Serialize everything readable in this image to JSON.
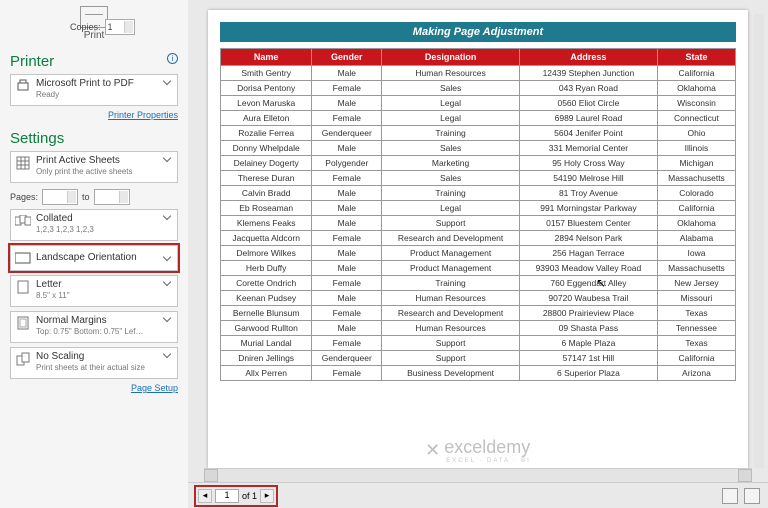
{
  "sidebar": {
    "print_label": "Print",
    "copies_label": "Copies:",
    "copies_value": "1",
    "printer_title": "Printer",
    "printer": {
      "name": "Microsoft Print to PDF",
      "status": "Ready"
    },
    "printer_properties": "Printer Properties",
    "settings_title": "Settings",
    "active_sheets": {
      "title": "Print Active Sheets",
      "sub": "Only print the active sheets"
    },
    "pages_label": "Pages:",
    "pages_to": "to",
    "collated": {
      "title": "Collated",
      "sub": "1,2,3   1,2,3   1,2,3"
    },
    "orientation": {
      "title": "Landscape Orientation"
    },
    "paper": {
      "title": "Letter",
      "sub": "8.5\" x 11\""
    },
    "margins": {
      "title": "Normal Margins",
      "sub": "Top: 0.75\" Bottom: 0.75\" Lef…"
    },
    "scaling": {
      "title": "No Scaling",
      "sub": "Print sheets at their actual size"
    },
    "page_setup": "Page Setup"
  },
  "preview": {
    "banner": "Making Page Adjustment",
    "watermark": "exceldemy",
    "watermark_sub": "EXCEL · DATA · BI",
    "footer": {
      "page": "1",
      "of": "of 1"
    }
  },
  "table": {
    "headers": [
      "Name",
      "Gender",
      "Designation",
      "Address",
      "State"
    ],
    "rows": [
      [
        "Smith Gentry",
        "Male",
        "Human Resources",
        "12439 Stephen Junction",
        "California"
      ],
      [
        "Dorisa Pentony",
        "Female",
        "Sales",
        "043 Ryan Road",
        "Oklahoma"
      ],
      [
        "Levon Maruska",
        "Male",
        "Legal",
        "0560 Eliot Circle",
        "Wisconsin"
      ],
      [
        "Aura Elleton",
        "Female",
        "Legal",
        "6989 Laurel Road",
        "Connecticut"
      ],
      [
        "Rozalie Ferrea",
        "Genderqueer",
        "Training",
        "5604 Jenifer Point",
        "Ohio"
      ],
      [
        "Donny Whelpdale",
        "Male",
        "Sales",
        "331 Memorial Center",
        "Illinois"
      ],
      [
        "Delainey Dogerty",
        "Polygender",
        "Marketing",
        "95 Holy Cross Way",
        "Michigan"
      ],
      [
        "Therese Duran",
        "Female",
        "Sales",
        "54190 Melrose Hill",
        "Massachusetts"
      ],
      [
        "Calvin Bradd",
        "Male",
        "Training",
        "81 Troy Avenue",
        "Colorado"
      ],
      [
        "Eb Roseaman",
        "Male",
        "Legal",
        "991 Morningstar Parkway",
        "California"
      ],
      [
        "Klemens Feaks",
        "Male",
        "Support",
        "0157 Bluestem Center",
        "Oklahoma"
      ],
      [
        "Jacquetta Aldcorn",
        "Female",
        "Research and Development",
        "2894 Nelson Park",
        "Alabama"
      ],
      [
        "Delmore Wilkes",
        "Male",
        "Product Management",
        "256 Hagan Terrace",
        "Iowa"
      ],
      [
        "Herb Duffy",
        "Male",
        "Product Management",
        "93903 Meadow Valley Road",
        "Massachusetts"
      ],
      [
        "Corette Ondrich",
        "Female",
        "Training",
        "760 Eggendart Alley",
        "New Jersey"
      ],
      [
        "Keenan Pudsey",
        "Male",
        "Human Resources",
        "90720 Waubesa Trail",
        "Missouri"
      ],
      [
        "Bernelle Blunsum",
        "Female",
        "Research and Development",
        "28800 Prairieview Place",
        "Texas"
      ],
      [
        "Garwood Rullton",
        "Male",
        "Human Resources",
        "09 Shasta Pass",
        "Tennessee"
      ],
      [
        "Murial Landal",
        "Female",
        "Support",
        "6 Maple Plaza",
        "Texas"
      ],
      [
        "Dniren Jellings",
        "Genderqueer",
        "Support",
        "57147 1st Hill",
        "California"
      ],
      [
        "Allx Perren",
        "Female",
        "Business Development",
        "6 Superior Plaza",
        "Arizona"
      ]
    ]
  }
}
